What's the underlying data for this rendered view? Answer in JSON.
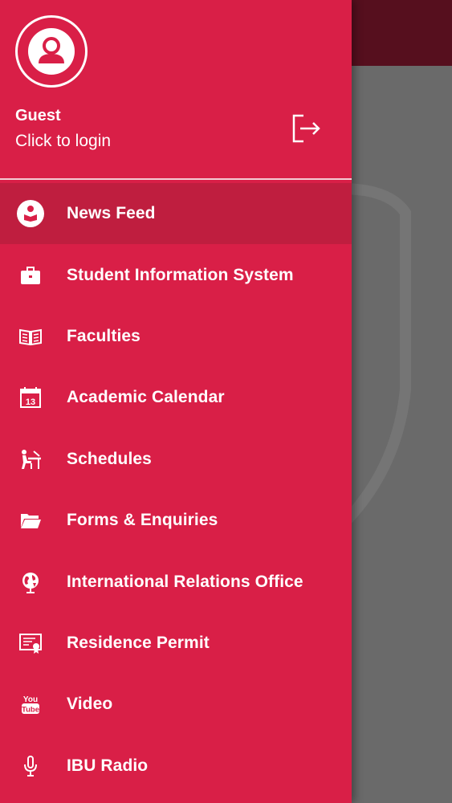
{
  "user": {
    "name": "Guest",
    "login_prompt": "Click to login"
  },
  "menu": {
    "active_index": 0,
    "items": [
      {
        "label": "News Feed",
        "icon": "news-feed-icon"
      },
      {
        "label": "Student Information System",
        "icon": "briefcase-icon"
      },
      {
        "label": "Faculties",
        "icon": "open-book-icon"
      },
      {
        "label": "Academic Calendar",
        "icon": "calendar-icon",
        "icon_text": "13"
      },
      {
        "label": "Schedules",
        "icon": "desk-student-icon"
      },
      {
        "label": "Forms & Enquiries",
        "icon": "folder-icon"
      },
      {
        "label": "International Relations Office",
        "icon": "globe-icon"
      },
      {
        "label": "Residence Permit",
        "icon": "certificate-icon"
      },
      {
        "label": "Video",
        "icon": "youtube-icon",
        "icon_text_top": "You",
        "icon_text_bottom": "Tube"
      },
      {
        "label": "IBU Radio",
        "icon": "microphone-icon"
      }
    ]
  },
  "colors": {
    "drawer": "#d91f47",
    "active_row": "#bf1e3f",
    "scrim_appbar": "#560f1e",
    "scrim": "#6a6a6a"
  }
}
